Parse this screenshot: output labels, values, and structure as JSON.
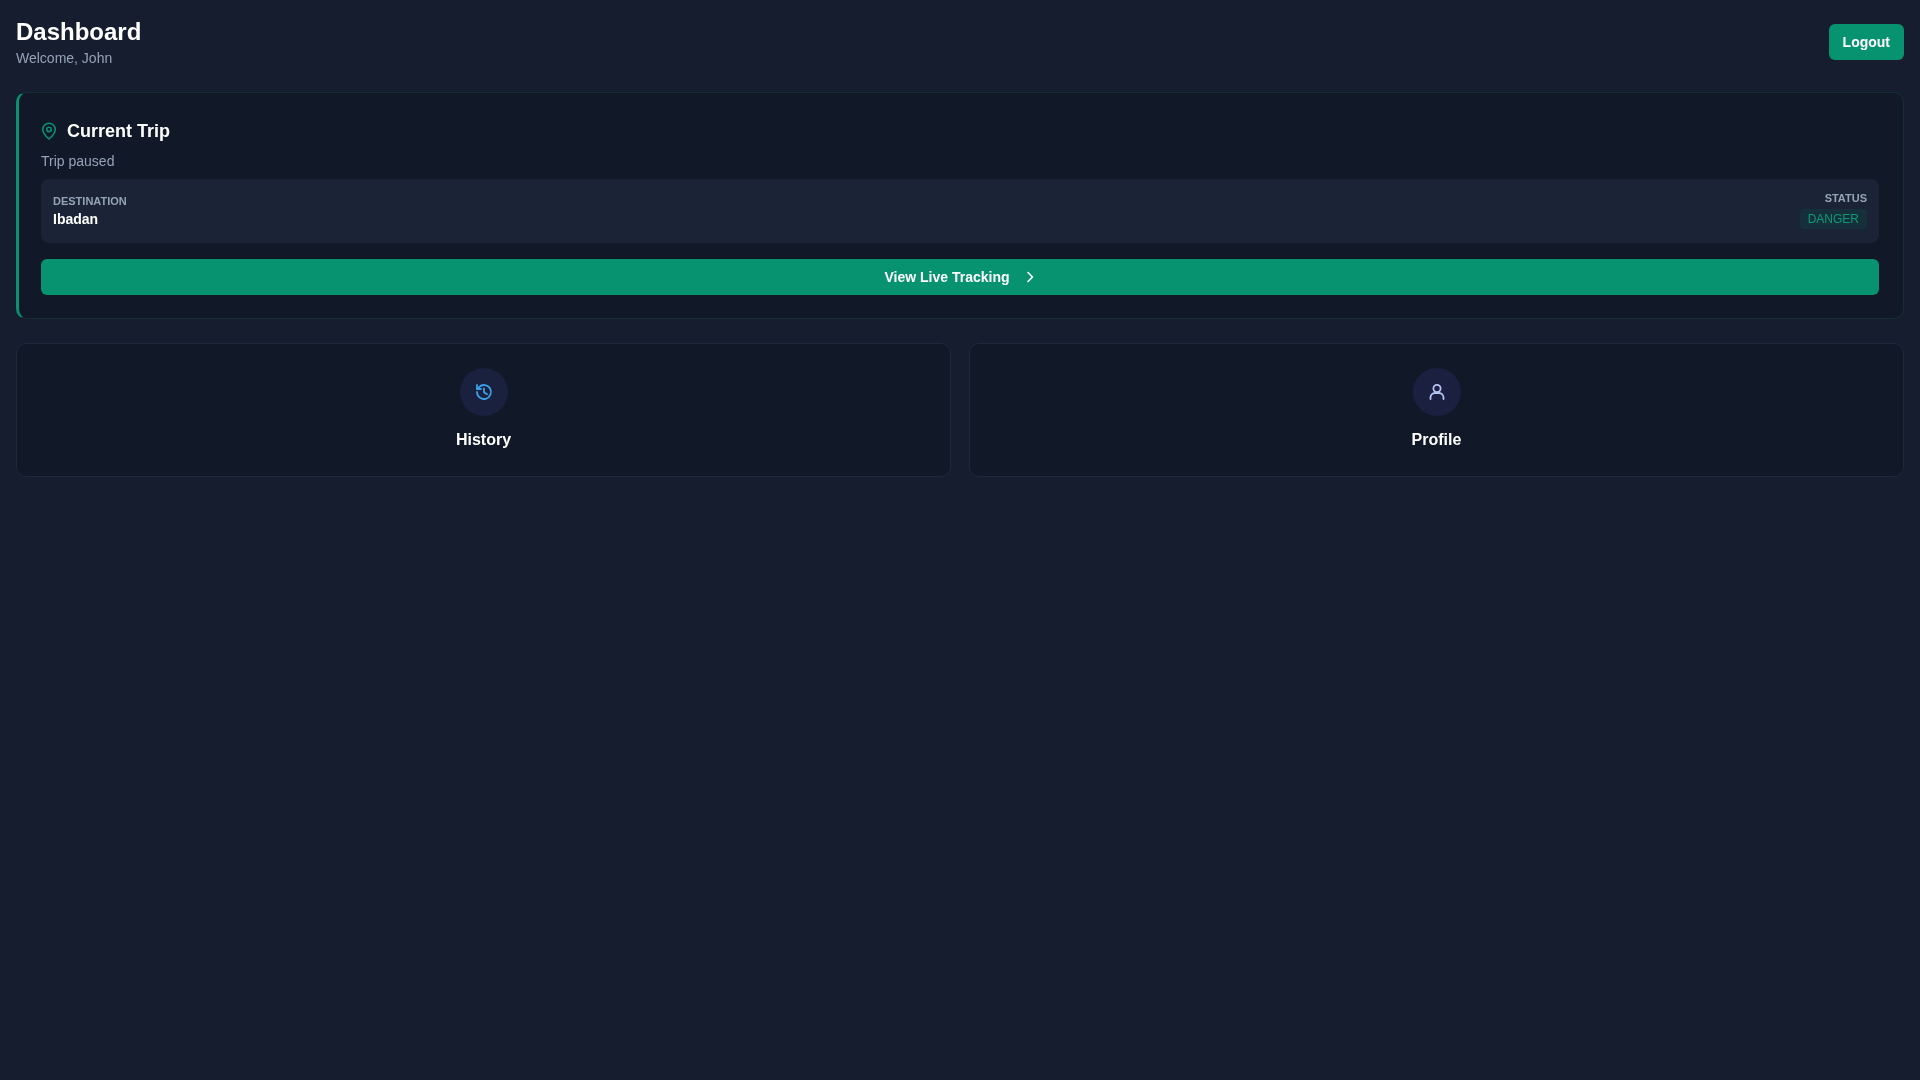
{
  "header": {
    "title": "Dashboard",
    "subtitle": "Welcome, John",
    "logout_button": "Logout"
  },
  "current_trip": {
    "title": "Current Trip",
    "status_text": "Trip paused",
    "destination": {
      "label": "DESTINATION",
      "value": "Ibadan"
    },
    "status": {
      "label": "STATUS",
      "badge": "DANGER"
    },
    "action_button": "View Live Tracking"
  },
  "quick_links": [
    {
      "kind": "history",
      "label": "History"
    },
    {
      "kind": "profile",
      "label": "Profile"
    }
  ]
}
